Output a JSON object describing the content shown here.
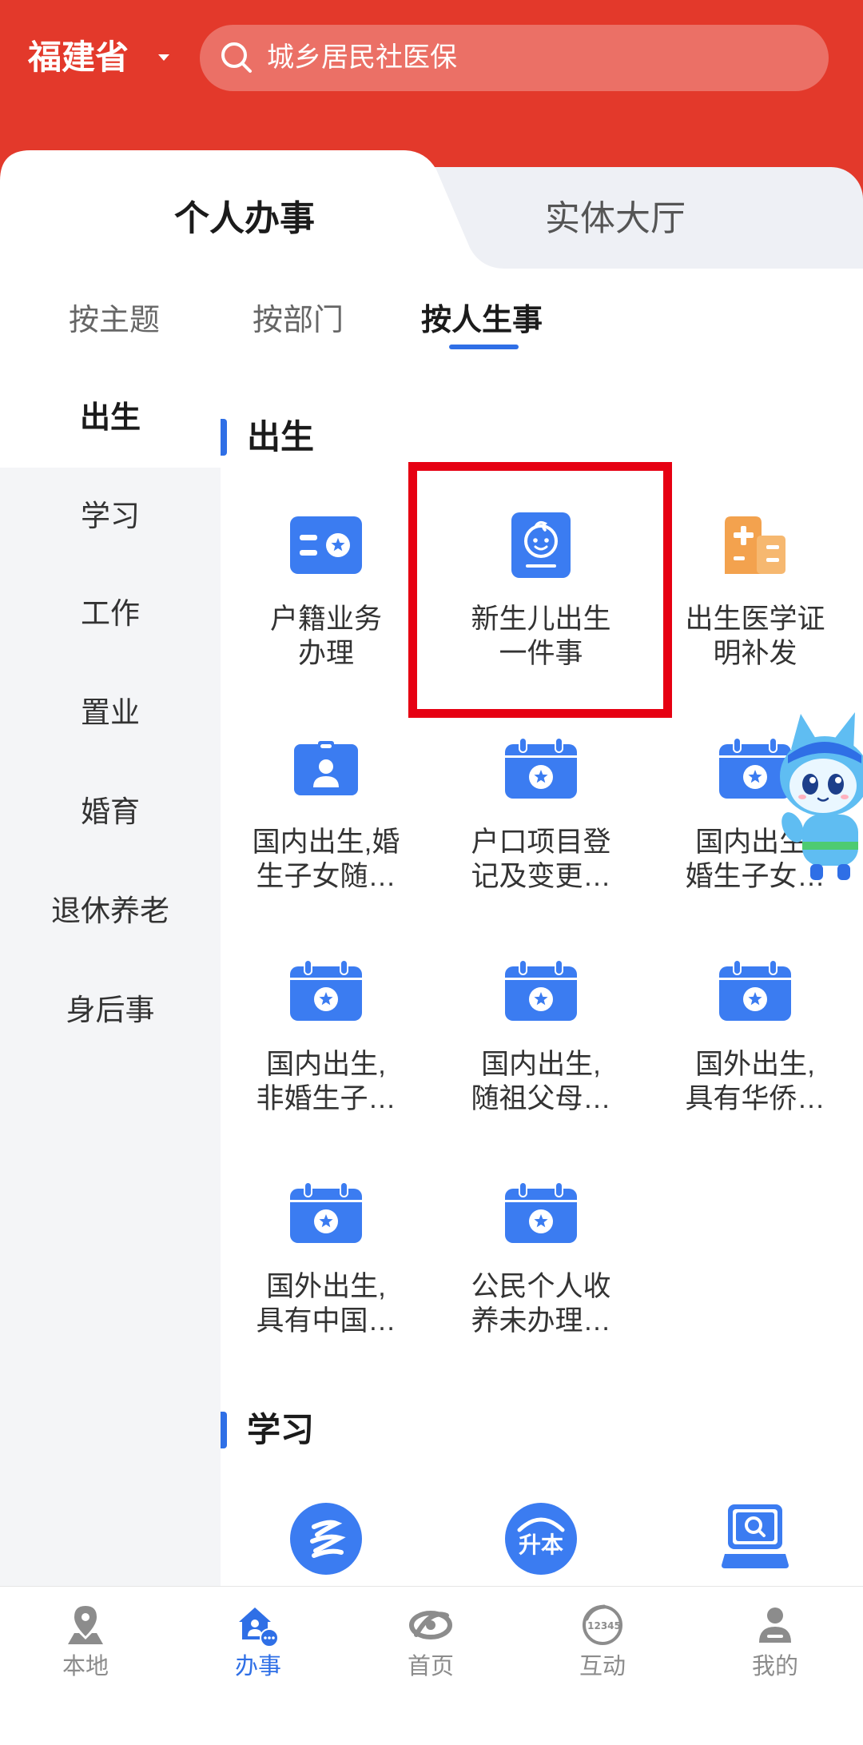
{
  "header": {
    "province": "福建省",
    "search_placeholder": "城乡居民社医保"
  },
  "main_tabs": [
    {
      "label": "个人办事",
      "active": true
    },
    {
      "label": "实体大厅",
      "active": false
    }
  ],
  "sub_tabs": [
    {
      "label": "按主题",
      "active": false
    },
    {
      "label": "按部门",
      "active": false
    },
    {
      "label": "按人生事",
      "active": true
    }
  ],
  "sidebar": [
    {
      "label": "出生",
      "active": true
    },
    {
      "label": "学习",
      "active": false
    },
    {
      "label": "工作",
      "active": false
    },
    {
      "label": "置业",
      "active": false
    },
    {
      "label": "婚育",
      "active": false
    },
    {
      "label": "退休养老",
      "active": false
    },
    {
      "label": "身后事",
      "active": false
    }
  ],
  "sections": [
    {
      "title": "出生",
      "items": [
        {
          "lines": [
            "户籍业务",
            "办理"
          ],
          "icon": "id-card-icon"
        },
        {
          "lines": [
            "新生儿出生",
            "一件事"
          ],
          "icon": "baby-face-icon",
          "highlighted": true
        },
        {
          "lines": [
            "出生医学证",
            "明补发"
          ],
          "icon": "hospital-building-icon"
        },
        {
          "lines": [
            "国内出生,婚",
            "生子女随…"
          ],
          "icon": "person-badge-icon"
        },
        {
          "lines": [
            "户口项目登",
            "记及变更…"
          ],
          "icon": "calendar-star-icon"
        },
        {
          "lines": [
            "国内出生,",
            "婚生子女…"
          ],
          "icon": "calendar-star-icon"
        },
        {
          "lines": [
            "国内出生,",
            "非婚生子…"
          ],
          "icon": "calendar-star-icon"
        },
        {
          "lines": [
            "国内出生,",
            "随祖父母…"
          ],
          "icon": "calendar-star-icon"
        },
        {
          "lines": [
            "国外出生,",
            "具有华侨…"
          ],
          "icon": "calendar-star-icon"
        },
        {
          "lines": [
            "国外出生,",
            "具有中国…"
          ],
          "icon": "calendar-star-icon"
        },
        {
          "lines": [
            "公民个人收",
            "养未办理…"
          ],
          "icon": "calendar-star-icon"
        }
      ]
    },
    {
      "title": "学习",
      "items": [
        {
          "icon": "education-swirl-icon"
        },
        {
          "icon": "upgrade-degree-icon",
          "icon_text": "升本"
        },
        {
          "icon": "laptop-search-icon"
        }
      ]
    }
  ],
  "bottom_nav": [
    {
      "label": "本地",
      "icon": "location-pin-icon",
      "active": false
    },
    {
      "label": "办事",
      "icon": "services-icon",
      "active": true
    },
    {
      "label": "首页",
      "icon": "home-logo-icon",
      "active": false
    },
    {
      "label": "互动",
      "icon": "hotline-icon",
      "icon_text": "12345",
      "active": false
    },
    {
      "label": "我的",
      "icon": "profile-icon",
      "active": false
    }
  ],
  "colors": {
    "header_red": "#e3392b",
    "accent_blue": "#2f6fe6",
    "icon_blue": "#3b7cf1",
    "icon_orange": "#f3a24e",
    "highlight_red": "#e60012",
    "sidebar_bg": "#f4f5f7",
    "nav_inactive": "#8c8c8c"
  }
}
